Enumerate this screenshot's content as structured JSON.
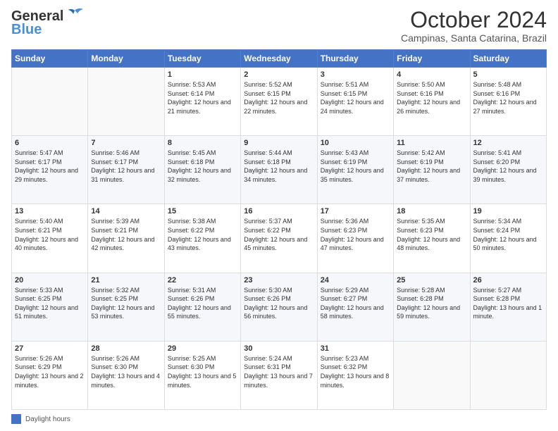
{
  "header": {
    "logo_line1": "General",
    "logo_line2": "Blue",
    "month_title": "October 2024",
    "location": "Campinas, Santa Catarina, Brazil"
  },
  "footer": {
    "legend_label": "Daylight hours"
  },
  "days_of_week": [
    "Sunday",
    "Monday",
    "Tuesday",
    "Wednesday",
    "Thursday",
    "Friday",
    "Saturday"
  ],
  "weeks": [
    [
      {
        "day": "",
        "sunrise": "",
        "sunset": "",
        "daylight": ""
      },
      {
        "day": "",
        "sunrise": "",
        "sunset": "",
        "daylight": ""
      },
      {
        "day": "1",
        "sunrise": "Sunrise: 5:53 AM",
        "sunset": "Sunset: 6:14 PM",
        "daylight": "Daylight: 12 hours and 21 minutes."
      },
      {
        "day": "2",
        "sunrise": "Sunrise: 5:52 AM",
        "sunset": "Sunset: 6:15 PM",
        "daylight": "Daylight: 12 hours and 22 minutes."
      },
      {
        "day": "3",
        "sunrise": "Sunrise: 5:51 AM",
        "sunset": "Sunset: 6:15 PM",
        "daylight": "Daylight: 12 hours and 24 minutes."
      },
      {
        "day": "4",
        "sunrise": "Sunrise: 5:50 AM",
        "sunset": "Sunset: 6:16 PM",
        "daylight": "Daylight: 12 hours and 26 minutes."
      },
      {
        "day": "5",
        "sunrise": "Sunrise: 5:48 AM",
        "sunset": "Sunset: 6:16 PM",
        "daylight": "Daylight: 12 hours and 27 minutes."
      }
    ],
    [
      {
        "day": "6",
        "sunrise": "Sunrise: 5:47 AM",
        "sunset": "Sunset: 6:17 PM",
        "daylight": "Daylight: 12 hours and 29 minutes."
      },
      {
        "day": "7",
        "sunrise": "Sunrise: 5:46 AM",
        "sunset": "Sunset: 6:17 PM",
        "daylight": "Daylight: 12 hours and 31 minutes."
      },
      {
        "day": "8",
        "sunrise": "Sunrise: 5:45 AM",
        "sunset": "Sunset: 6:18 PM",
        "daylight": "Daylight: 12 hours and 32 minutes."
      },
      {
        "day": "9",
        "sunrise": "Sunrise: 5:44 AM",
        "sunset": "Sunset: 6:18 PM",
        "daylight": "Daylight: 12 hours and 34 minutes."
      },
      {
        "day": "10",
        "sunrise": "Sunrise: 5:43 AM",
        "sunset": "Sunset: 6:19 PM",
        "daylight": "Daylight: 12 hours and 35 minutes."
      },
      {
        "day": "11",
        "sunrise": "Sunrise: 5:42 AM",
        "sunset": "Sunset: 6:19 PM",
        "daylight": "Daylight: 12 hours and 37 minutes."
      },
      {
        "day": "12",
        "sunrise": "Sunrise: 5:41 AM",
        "sunset": "Sunset: 6:20 PM",
        "daylight": "Daylight: 12 hours and 39 minutes."
      }
    ],
    [
      {
        "day": "13",
        "sunrise": "Sunrise: 5:40 AM",
        "sunset": "Sunset: 6:21 PM",
        "daylight": "Daylight: 12 hours and 40 minutes."
      },
      {
        "day": "14",
        "sunrise": "Sunrise: 5:39 AM",
        "sunset": "Sunset: 6:21 PM",
        "daylight": "Daylight: 12 hours and 42 minutes."
      },
      {
        "day": "15",
        "sunrise": "Sunrise: 5:38 AM",
        "sunset": "Sunset: 6:22 PM",
        "daylight": "Daylight: 12 hours and 43 minutes."
      },
      {
        "day": "16",
        "sunrise": "Sunrise: 5:37 AM",
        "sunset": "Sunset: 6:22 PM",
        "daylight": "Daylight: 12 hours and 45 minutes."
      },
      {
        "day": "17",
        "sunrise": "Sunrise: 5:36 AM",
        "sunset": "Sunset: 6:23 PM",
        "daylight": "Daylight: 12 hours and 47 minutes."
      },
      {
        "day": "18",
        "sunrise": "Sunrise: 5:35 AM",
        "sunset": "Sunset: 6:23 PM",
        "daylight": "Daylight: 12 hours and 48 minutes."
      },
      {
        "day": "19",
        "sunrise": "Sunrise: 5:34 AM",
        "sunset": "Sunset: 6:24 PM",
        "daylight": "Daylight: 12 hours and 50 minutes."
      }
    ],
    [
      {
        "day": "20",
        "sunrise": "Sunrise: 5:33 AM",
        "sunset": "Sunset: 6:25 PM",
        "daylight": "Daylight: 12 hours and 51 minutes."
      },
      {
        "day": "21",
        "sunrise": "Sunrise: 5:32 AM",
        "sunset": "Sunset: 6:25 PM",
        "daylight": "Daylight: 12 hours and 53 minutes."
      },
      {
        "day": "22",
        "sunrise": "Sunrise: 5:31 AM",
        "sunset": "Sunset: 6:26 PM",
        "daylight": "Daylight: 12 hours and 55 minutes."
      },
      {
        "day": "23",
        "sunrise": "Sunrise: 5:30 AM",
        "sunset": "Sunset: 6:26 PM",
        "daylight": "Daylight: 12 hours and 56 minutes."
      },
      {
        "day": "24",
        "sunrise": "Sunrise: 5:29 AM",
        "sunset": "Sunset: 6:27 PM",
        "daylight": "Daylight: 12 hours and 58 minutes."
      },
      {
        "day": "25",
        "sunrise": "Sunrise: 5:28 AM",
        "sunset": "Sunset: 6:28 PM",
        "daylight": "Daylight: 12 hours and 59 minutes."
      },
      {
        "day": "26",
        "sunrise": "Sunrise: 5:27 AM",
        "sunset": "Sunset: 6:28 PM",
        "daylight": "Daylight: 13 hours and 1 minute."
      }
    ],
    [
      {
        "day": "27",
        "sunrise": "Sunrise: 5:26 AM",
        "sunset": "Sunset: 6:29 PM",
        "daylight": "Daylight: 13 hours and 2 minutes."
      },
      {
        "day": "28",
        "sunrise": "Sunrise: 5:26 AM",
        "sunset": "Sunset: 6:30 PM",
        "daylight": "Daylight: 13 hours and 4 minutes."
      },
      {
        "day": "29",
        "sunrise": "Sunrise: 5:25 AM",
        "sunset": "Sunset: 6:30 PM",
        "daylight": "Daylight: 13 hours and 5 minutes."
      },
      {
        "day": "30",
        "sunrise": "Sunrise: 5:24 AM",
        "sunset": "Sunset: 6:31 PM",
        "daylight": "Daylight: 13 hours and 7 minutes."
      },
      {
        "day": "31",
        "sunrise": "Sunrise: 5:23 AM",
        "sunset": "Sunset: 6:32 PM",
        "daylight": "Daylight: 13 hours and 8 minutes."
      },
      {
        "day": "",
        "sunrise": "",
        "sunset": "",
        "daylight": ""
      },
      {
        "day": "",
        "sunrise": "",
        "sunset": "",
        "daylight": ""
      }
    ]
  ]
}
